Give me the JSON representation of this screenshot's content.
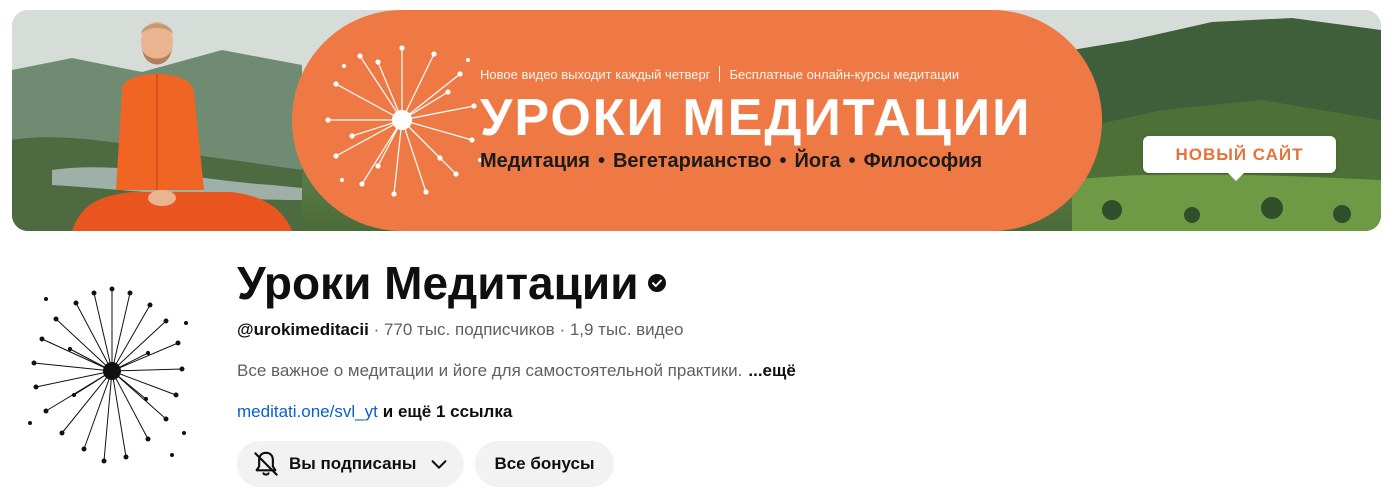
{
  "banner": {
    "top_line_left": "Новое видео выходит каждый четверг",
    "top_line_right": "Бесплатные онлайн-курсы медитации",
    "title": "УРОКИ МЕДИТАЦИИ",
    "tags": [
      "Медитация",
      "Вегетарианство",
      "Йога",
      "Философия"
    ],
    "new_site_label": "НОВЫЙ САЙТ",
    "accent_color": "#ef7944"
  },
  "channel": {
    "name": "Уроки Медитации",
    "handle": "@urokimeditacii",
    "subscribers": "770 тыс. подписчиков",
    "videos": "1,9 тыс. видео",
    "description": "Все важное о медитации и йоге для самостоятельной практики.",
    "more_label": "...ещё",
    "link_text": "meditati.one/svl_yt",
    "extra_links": "и ещё 1 ссылка",
    "verified_icon": "verified-check-icon"
  },
  "actions": {
    "subscribed_label": "Вы подписаны",
    "bonuses_label": "Все бонусы"
  },
  "colors": {
    "link": "#065fd4",
    "button_bg": "#f2f2f2",
    "secondary_text": "#606060"
  }
}
